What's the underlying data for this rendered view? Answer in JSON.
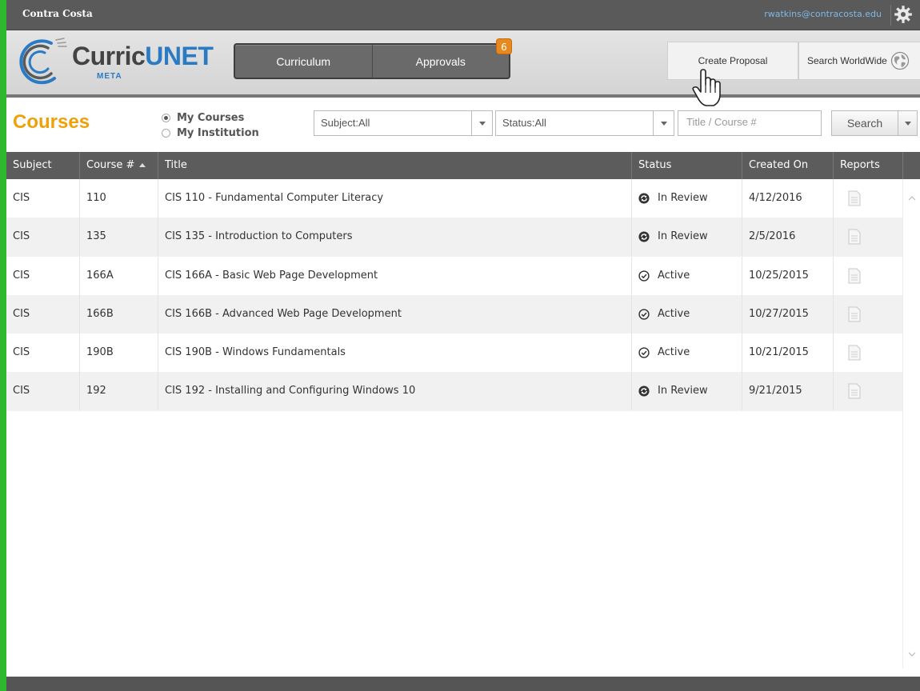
{
  "topbar": {
    "org_name": "Contra Costa",
    "user_email": "rwatkins@contracosta.edu",
    "settings_icon": "gear-icon"
  },
  "header": {
    "logo_text_main": "Curric",
    "logo_text_accent": "UNET",
    "logo_sub": "META",
    "nav": [
      {
        "label": "Curriculum"
      },
      {
        "label": "Approvals"
      }
    ],
    "approvals_badge": "6",
    "create_proposal": "Create Proposal",
    "search_worldwide": "Search WorldWide"
  },
  "filters": {
    "title": "Courses",
    "radio_options": [
      "My Courses",
      "My Institution"
    ],
    "radio_selected": 0,
    "subject_select": "Subject:All",
    "status_select": "Status:All",
    "search_placeholder": "Title / Course #",
    "search_button": "Search"
  },
  "table": {
    "headers": [
      "Subject",
      "Course #",
      "Title",
      "Status",
      "Created On",
      "Reports"
    ],
    "sorted_column": 1,
    "rows": [
      {
        "subject": "CIS",
        "course": "110",
        "title": "CIS 110 - Fundamental Computer Literacy",
        "status": "In Review",
        "status_icon": "refresh-icon",
        "created": "4/12/2016"
      },
      {
        "subject": "CIS",
        "course": "135",
        "title": "CIS 135 - Introduction to Computers",
        "status": "In Review",
        "status_icon": "refresh-icon",
        "created": "2/5/2016"
      },
      {
        "subject": "CIS",
        "course": "166A",
        "title": "CIS 166A - Basic Web Page Development",
        "status": "Active",
        "status_icon": "check-circle-icon",
        "created": "10/25/2015"
      },
      {
        "subject": "CIS",
        "course": "166B",
        "title": "CIS 166B - Advanced Web Page Development",
        "status": "Active",
        "status_icon": "check-circle-icon",
        "created": "10/27/2015"
      },
      {
        "subject": "CIS",
        "course": "190B",
        "title": "CIS 190B - Windows Fundamentals",
        "status": "Active",
        "status_icon": "check-circle-icon",
        "created": "10/21/2015"
      },
      {
        "subject": "CIS",
        "course": "192",
        "title": "CIS 192 - Installing and Configuring Windows 10",
        "status": "In Review",
        "status_icon": "refresh-icon",
        "created": "9/21/2015"
      }
    ]
  },
  "colors": {
    "accent_orange": "#f0a10a",
    "logo_blue": "#2a7bc4",
    "header_dark": "#5c5c5c",
    "frame_green": "#2eb82e"
  }
}
